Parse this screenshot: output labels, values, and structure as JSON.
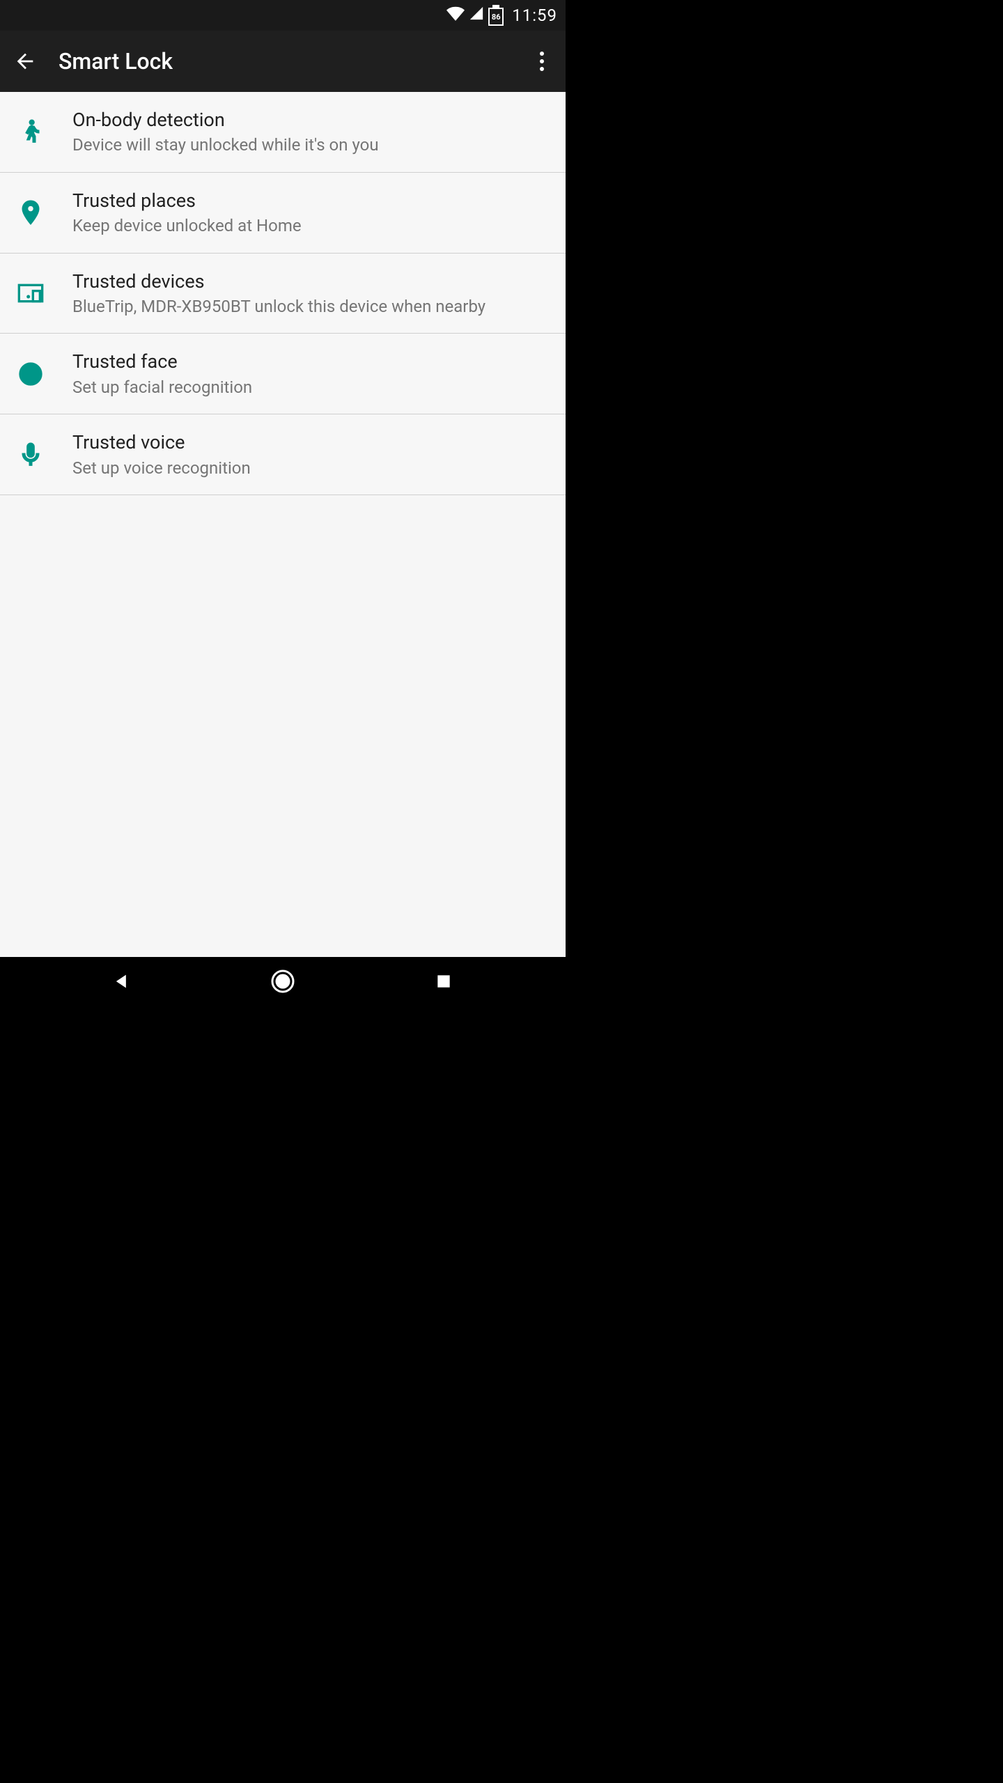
{
  "status": {
    "battery_pct": "86",
    "time": "11:59"
  },
  "header": {
    "title": "Smart Lock"
  },
  "accent_color": "#009688",
  "items": [
    {
      "icon": "walk-icon",
      "title": "On-body detection",
      "subtitle": "Device will stay unlocked while it's on you"
    },
    {
      "icon": "place-icon",
      "title": "Trusted places",
      "subtitle": "Keep device unlocked at Home"
    },
    {
      "icon": "devices-icon",
      "title": "Trusted devices",
      "subtitle": "BlueTrip, MDR-XB950BT unlock this device when nearby"
    },
    {
      "icon": "face-icon",
      "title": "Trusted face",
      "subtitle": "Set up facial recognition"
    },
    {
      "icon": "voice-icon",
      "title": "Trusted voice",
      "subtitle": "Set up voice recognition"
    }
  ]
}
